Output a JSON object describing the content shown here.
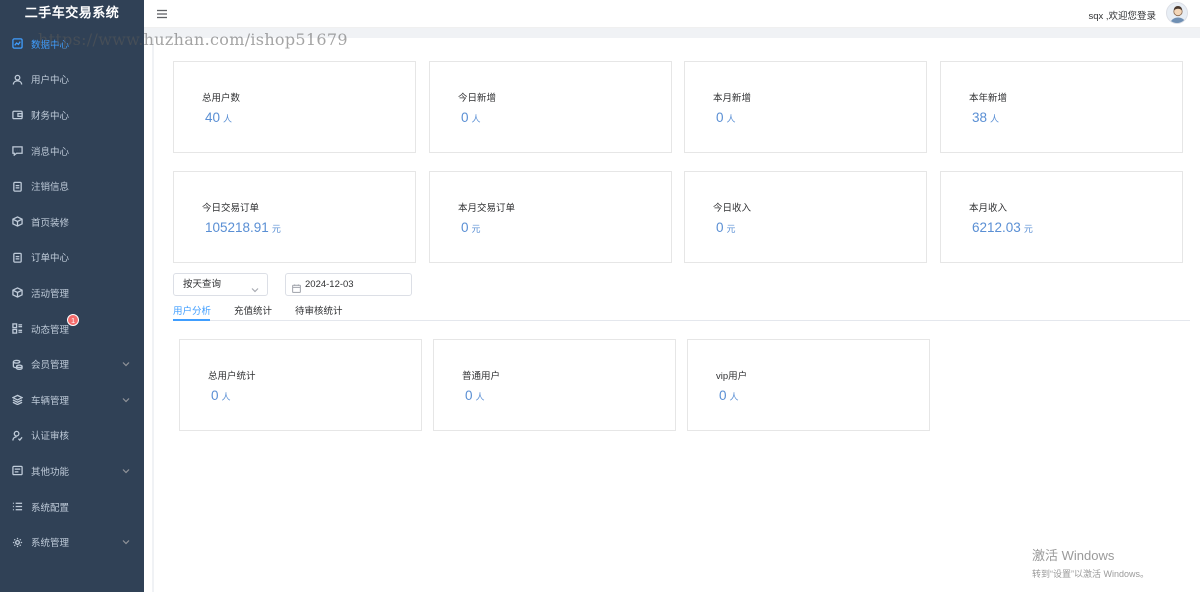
{
  "app": {
    "title": "二手车交易系统"
  },
  "sidebar": {
    "items": [
      {
        "label": "数据中心",
        "icon": "dashboard-icon",
        "active": true
      },
      {
        "label": "用户中心",
        "icon": "user-icon"
      },
      {
        "label": "财务中心",
        "icon": "wallet-icon"
      },
      {
        "label": "消息中心",
        "icon": "message-icon"
      },
      {
        "label": "注销信息",
        "icon": "document-icon"
      },
      {
        "label": "首页装修",
        "icon": "box-icon"
      },
      {
        "label": "订单中心",
        "icon": "document-icon"
      },
      {
        "label": "活动管理",
        "icon": "box-icon"
      },
      {
        "label": "动态管理",
        "icon": "grid-list-icon",
        "badge": "1"
      },
      {
        "label": "会员管理",
        "icon": "coins-icon",
        "expandable": true
      },
      {
        "label": "车辆管理",
        "icon": "layers-icon",
        "expandable": true
      },
      {
        "label": "认证审核",
        "icon": "user-check-icon"
      },
      {
        "label": "其他功能",
        "icon": "list-board-icon",
        "expandable": true
      },
      {
        "label": "系统配置",
        "icon": "menu-list-icon"
      },
      {
        "label": "系统管理",
        "icon": "gear-icon",
        "expandable": true
      }
    ]
  },
  "header": {
    "welcome": "sqx ,欢迎您登录"
  },
  "stats_row1": [
    {
      "label": "总用户数",
      "value": "40",
      "unit": "人"
    },
    {
      "label": "今日新增",
      "value": "0",
      "unit": "人"
    },
    {
      "label": "本月新增",
      "value": "0",
      "unit": "人"
    },
    {
      "label": "本年新增",
      "value": "38",
      "unit": "人"
    }
  ],
  "stats_row2": [
    {
      "label": "今日交易订单",
      "value": "105218.91",
      "unit": "元"
    },
    {
      "label": "本月交易订单",
      "value": "0",
      "unit": "元"
    },
    {
      "label": "今日收入",
      "value": "0",
      "unit": "元"
    },
    {
      "label": "本月收入",
      "value": "6212.03",
      "unit": "元"
    }
  ],
  "filters": {
    "query_type": "按天查询",
    "date": "2024-12-03"
  },
  "tabs": [
    {
      "label": "用户分析",
      "active": true
    },
    {
      "label": "充值统计"
    },
    {
      "label": "待审核统计"
    }
  ],
  "user_stats": [
    {
      "label": "总用户统计",
      "value": "0",
      "unit": "人"
    },
    {
      "label": "普通用户",
      "value": "0",
      "unit": "人"
    },
    {
      "label": "vip用户",
      "value": "0",
      "unit": "人"
    }
  ],
  "watermarks": {
    "url": "https://www.huzhan.com/ishop51679",
    "windows_title": "激活 Windows",
    "windows_subtitle": "转到“设置”以激活 Windows。"
  },
  "colors": {
    "sidebar_bg": "#304156",
    "accent": "#409eff",
    "value": "#5a8fd4",
    "badge": "#f56c6c"
  }
}
